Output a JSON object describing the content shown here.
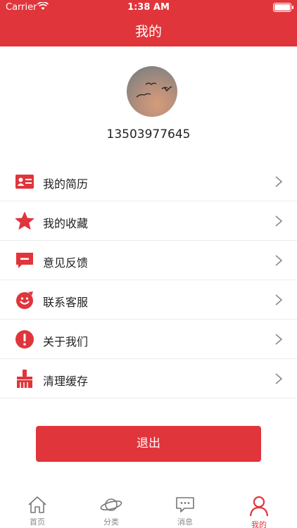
{
  "status_bar": {
    "carrier": "Carrier",
    "time": "1:38 AM"
  },
  "nav": {
    "title": "我的"
  },
  "profile": {
    "phone": "13503977645",
    "avatar_icon": "avatar-image"
  },
  "menu": [
    {
      "label": "我的简历",
      "icon": "resume-icon"
    },
    {
      "label": "我的收藏",
      "icon": "star-icon"
    },
    {
      "label": "意见反馈",
      "icon": "feedback-icon"
    },
    {
      "label": "联系客服",
      "icon": "customer-service-icon"
    },
    {
      "label": "关于我们",
      "icon": "info-icon"
    },
    {
      "label": "清理缓存",
      "icon": "clean-cache-icon"
    }
  ],
  "logout_label": "退出",
  "tabs": [
    {
      "label": "首页",
      "icon": "home-icon",
      "active": false
    },
    {
      "label": "分类",
      "icon": "planet-icon",
      "active": false
    },
    {
      "label": "消息",
      "icon": "message-icon",
      "active": false
    },
    {
      "label": "我的",
      "icon": "person-icon",
      "active": true
    }
  ],
  "colors": {
    "brand": "#e0353b",
    "text": "#222222",
    "divider": "#ececec",
    "tab_inactive": "#888888"
  }
}
